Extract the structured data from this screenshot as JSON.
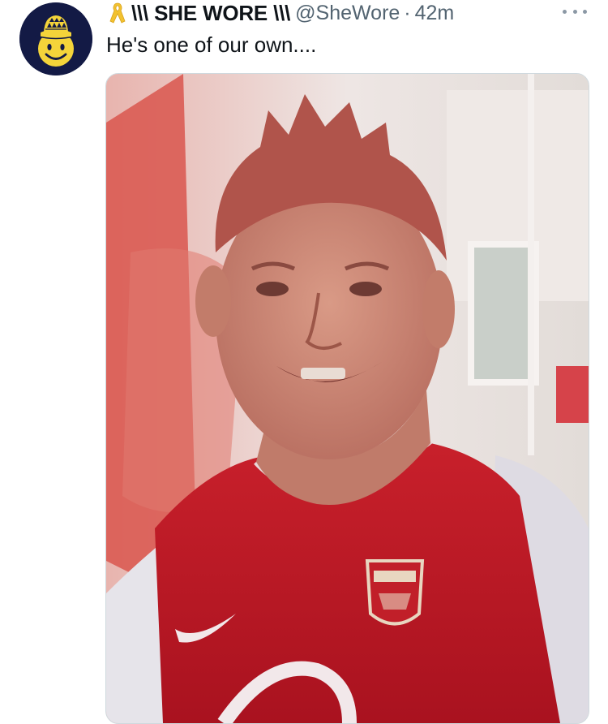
{
  "tweet": {
    "display_name": "\\\\\\ SHE WORE \\\\\\",
    "handle": "@SheWore",
    "separator": "·",
    "time": "42m",
    "text": "He's one of our own....",
    "icons": {
      "badge": "yellow-ribbon-icon",
      "more": "more-icon"
    },
    "avatar": {
      "description_icon": "smiley-bucket-hat",
      "background_color": "#131a45",
      "face_color": "#f4d43a"
    },
    "media": {
      "kind": "photo",
      "dominant_colors": [
        "#d21f2b",
        "#f0e6e6",
        "#d98a7e"
      ]
    }
  },
  "colors": {
    "text_primary": "#0f1419",
    "text_secondary": "#536471",
    "border": "#cfd9de"
  }
}
